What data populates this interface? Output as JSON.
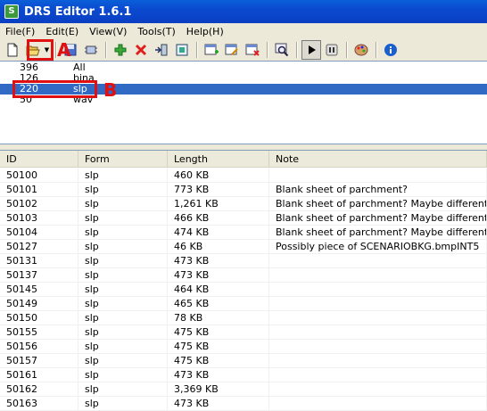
{
  "window": {
    "title": "DRS Editor 1.6.1",
    "icon_glyph": "S"
  },
  "menu": [
    "File(F)",
    "Edit(E)",
    "View(V)",
    "Tools(T)",
    "Help(H)"
  ],
  "annotations": {
    "a": "A",
    "b": "B"
  },
  "top_list": [
    {
      "count": "396",
      "type": "All"
    },
    {
      "count": "126",
      "type": "bina"
    },
    {
      "count": "220",
      "type": "slp",
      "selected": true
    },
    {
      "count": "50",
      "type": "wav"
    }
  ],
  "table": {
    "headers": [
      "ID",
      "Form",
      "Length",
      "Note"
    ],
    "rows": [
      [
        "50100",
        "slp",
        "460 KB",
        ""
      ],
      [
        "50101",
        "slp",
        "773 KB",
        "Blank sheet of parchment?"
      ],
      [
        "50102",
        "slp",
        "1,261 KB",
        "Blank sheet of parchment? Maybe different s"
      ],
      [
        "50103",
        "slp",
        "466 KB",
        "Blank sheet of parchment? Maybe different s"
      ],
      [
        "50104",
        "slp",
        "474 KB",
        "Blank sheet of parchment? Maybe different s"
      ],
      [
        "50127",
        "slp",
        "46 KB",
        "Possibly piece of  SCENARIOBKG.bmpINT5"
      ],
      [
        "50131",
        "slp",
        "473 KB",
        ""
      ],
      [
        "50137",
        "slp",
        "473 KB",
        ""
      ],
      [
        "50145",
        "slp",
        "464 KB",
        ""
      ],
      [
        "50149",
        "slp",
        "465 KB",
        ""
      ],
      [
        "50150",
        "slp",
        "78 KB",
        ""
      ],
      [
        "50155",
        "slp",
        "475 KB",
        ""
      ],
      [
        "50156",
        "slp",
        "475 KB",
        ""
      ],
      [
        "50157",
        "slp",
        "475 KB",
        ""
      ],
      [
        "50161",
        "slp",
        "473 KB",
        ""
      ],
      [
        "50162",
        "slp",
        "3,369 KB",
        ""
      ],
      [
        "50163",
        "slp",
        "473 KB",
        ""
      ]
    ]
  },
  "colors": {
    "selection": "#316ac5",
    "annotation": "#e01010",
    "titlebar": "#0a4fd0"
  }
}
